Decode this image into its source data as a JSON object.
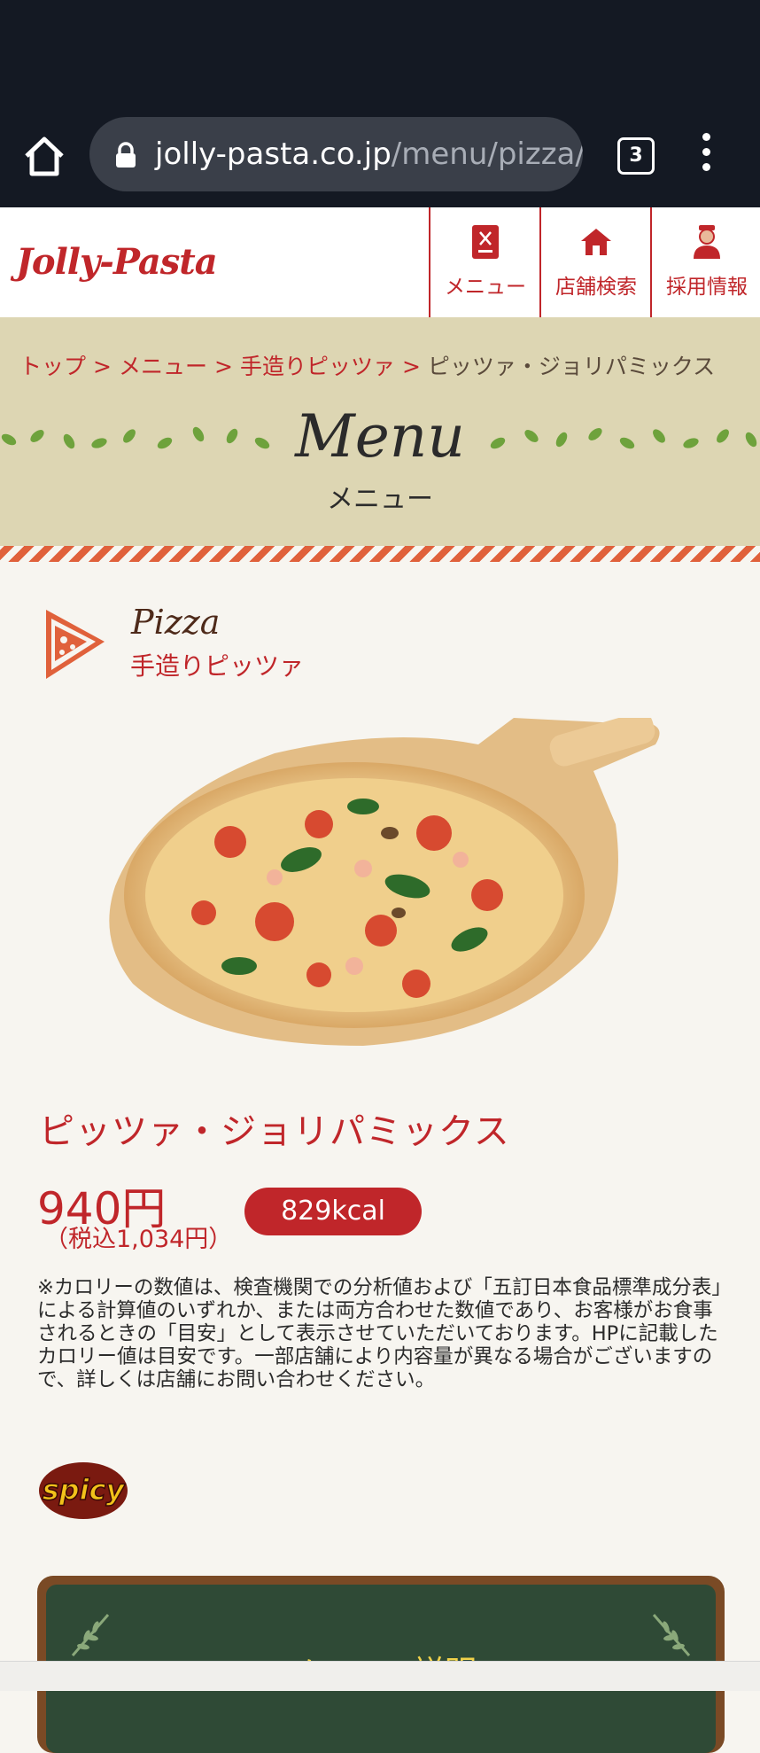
{
  "browser": {
    "url_host": "jolly-pasta.co.jp",
    "url_path": "/menu/pizza/pi",
    "tab_count": "3",
    "icons": [
      "home-icon",
      "lock-icon",
      "tabs-icon",
      "more-vert-icon"
    ]
  },
  "header": {
    "logo": "Jolly-Pasta",
    "nav": [
      {
        "label": "メニュー",
        "icon": "menu-book-icon"
      },
      {
        "label": "店舗検索",
        "icon": "store-icon"
      },
      {
        "label": "採用情報",
        "icon": "staff-icon"
      }
    ]
  },
  "breadcrumb": {
    "items": [
      "トップ",
      "メニュー",
      "手造りピッツァ"
    ],
    "current": "ピッツァ・ジョリパミックス",
    "separator": ">"
  },
  "hero": {
    "title": "Menu",
    "subtitle": "メニュー"
  },
  "category": {
    "name_en": "Pizza",
    "name_jp": "手造りピッツァ",
    "icon": "pizza-slice-icon"
  },
  "item": {
    "name": "ピッツァ・ジョリパミックス",
    "price": "940円",
    "price_tax": "（税込1,034円）",
    "kcal": "829kcal",
    "note": "※カロリーの数値は、検査機関での分析値および「五訂日本食品標準成分表」による計算値のいずれか、または両方合わせた数値であり、お客様がお食事されるときの「目安」として表示させていただいております。HPに記載したカロリー値は目安です。一部店舗により内容量が異なる場合がございますので、詳しくは店舗にお問い合わせください。",
    "badge": "spicy"
  },
  "description_board": {
    "title": "メニュー説明"
  },
  "colors": {
    "brand_red": "#c0262a",
    "hero_bg": "#ddd6b3",
    "page_bg": "#f7f5f0",
    "board_green": "#2f4a36"
  }
}
